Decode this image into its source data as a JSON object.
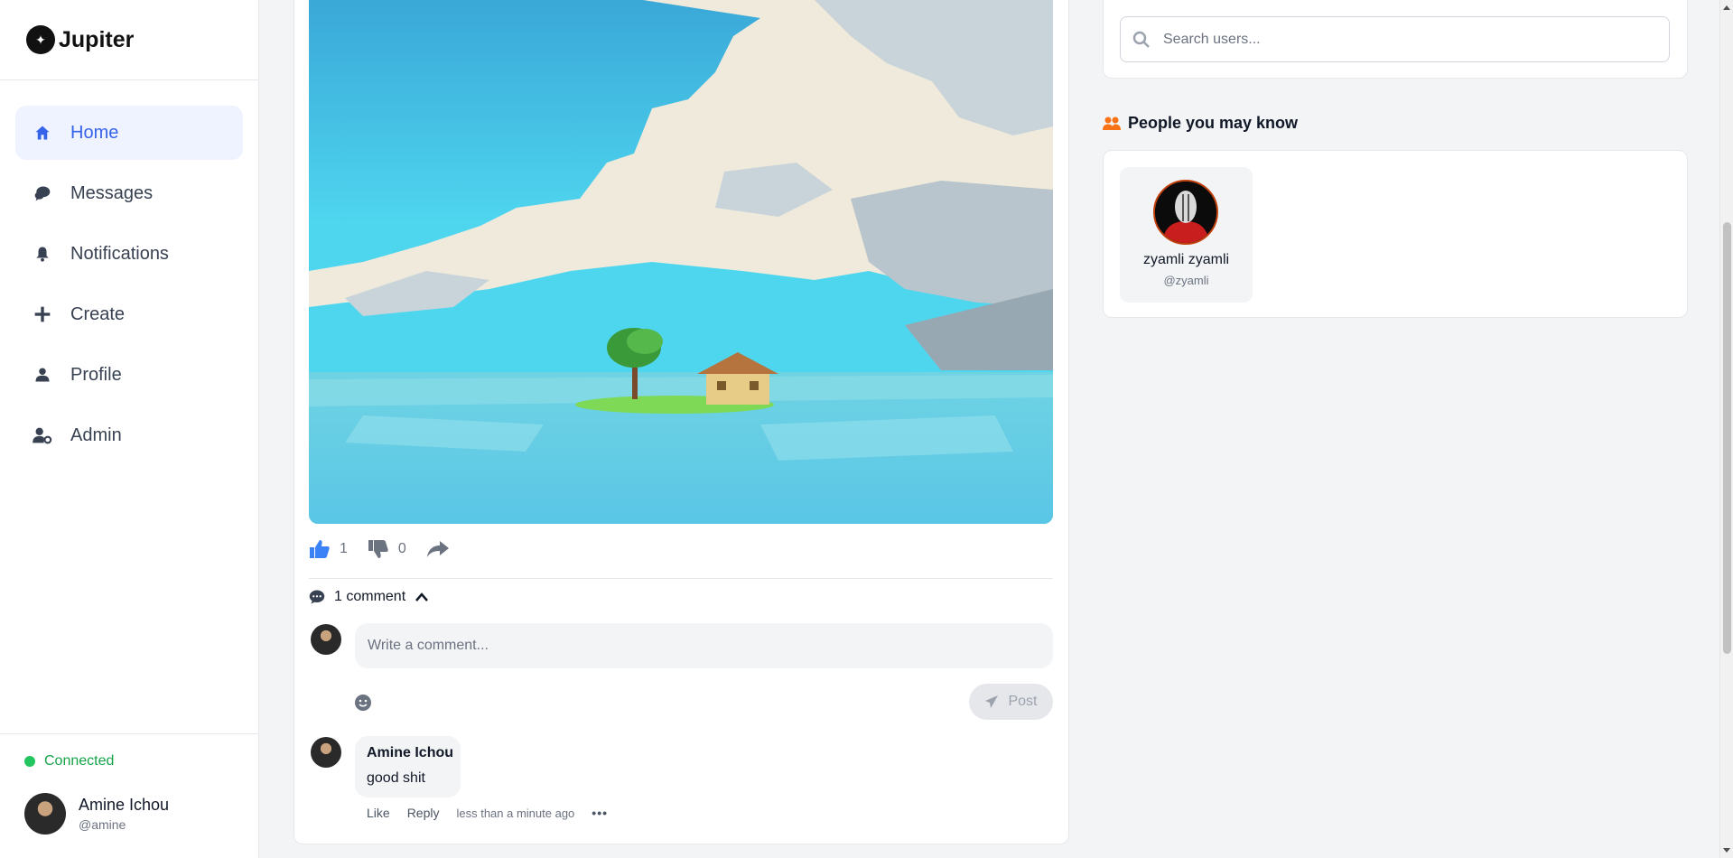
{
  "app": {
    "name": "Jupiter"
  },
  "sidebar": {
    "items": [
      {
        "label": "Home",
        "icon": "home-icon",
        "active": true
      },
      {
        "label": "Messages",
        "icon": "chat-icon"
      },
      {
        "label": "Notifications",
        "icon": "bell-icon"
      },
      {
        "label": "Create",
        "icon": "plus-icon"
      },
      {
        "label": "Profile",
        "icon": "user-icon"
      },
      {
        "label": "Admin",
        "icon": "user-cog-icon"
      }
    ],
    "status": "Connected",
    "status_color": "#22c55e",
    "user": {
      "name": "Amine Ichou",
      "handle": "@amine"
    }
  },
  "post": {
    "likes": "1",
    "dislikes": "0",
    "comment_count_label": "1 comment",
    "comment_placeholder": "Write a comment...",
    "post_button": "Post",
    "comments": [
      {
        "author": "Amine Ichou",
        "text": "good shit",
        "like_label": "Like",
        "reply_label": "Reply",
        "time": "less than a minute ago"
      }
    ]
  },
  "right": {
    "search_placeholder": "Search users...",
    "pymk_title": "People you may know",
    "people": [
      {
        "name": "zyamli zyamli",
        "handle": "@zyamli"
      }
    ]
  },
  "colors": {
    "accent": "#3563e9",
    "active_bg": "#eff2ff",
    "pymk_icon": "#f97316"
  }
}
